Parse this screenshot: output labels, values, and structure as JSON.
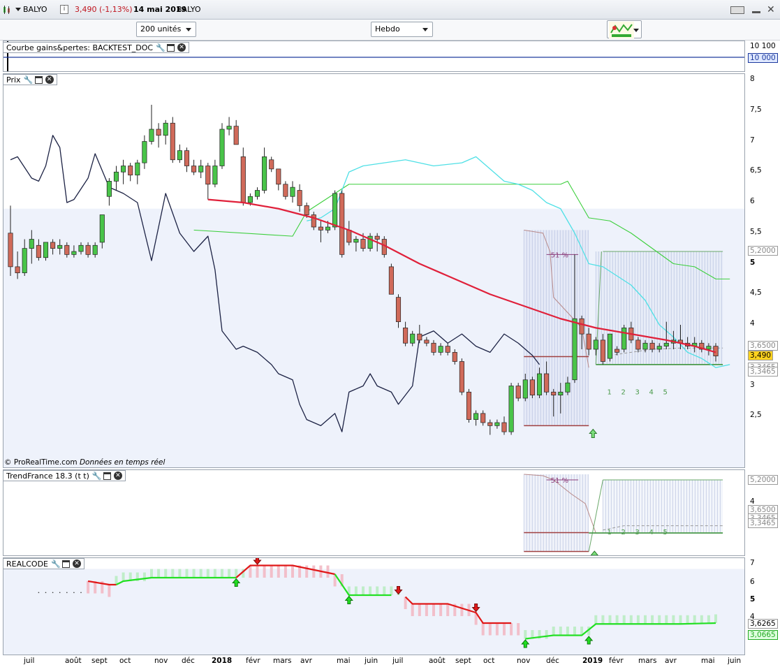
{
  "header": {
    "symbol": "BALYO",
    "price_change": "3,490 (-1,13%)",
    "date": "14 mai 2019",
    "name": "BALYO"
  },
  "toolbar": {
    "units": "200 unités",
    "timeframe": "Hebdo"
  },
  "panels": {
    "equity": {
      "title": "Courbe gains&pertes: BACKTEST_DOC",
      "axis": [
        "10 100"
      ],
      "tag": "10 000"
    },
    "price": {
      "title": "Prix",
      "axis": [
        "8",
        "7,5",
        "7",
        "6,5",
        "6",
        "5,5",
        "5",
        "4,5",
        "4",
        "3",
        "2,5"
      ],
      "tags": {
        "t1": "5,2000",
        "t2": "3,6500",
        "t3": "3,490",
        "t4": "3,3465",
        "t5": "3,3465"
      },
      "pct_label": "51 %",
      "counts": [
        "1",
        "2",
        "3",
        "4",
        "5"
      ],
      "copyright": "© ProRealTime.com",
      "realtime": "Données en temps réel"
    },
    "trend": {
      "title": "TrendFrance 18.3 (t t)",
      "axis": [
        "4"
      ],
      "tags": {
        "t1": "5,2000",
        "t2": "3,6500",
        "t3": "3,3465",
        "t4": "3,3465"
      },
      "pct_label": "51 %",
      "counts": [
        "1",
        "2",
        "3",
        "4",
        "5"
      ]
    },
    "realcode": {
      "title": "REALCODE",
      "axis": [
        "7",
        "6",
        "5",
        "4"
      ],
      "tags": {
        "t1": "3,6265",
        "t2": "3,0665"
      }
    }
  },
  "x_axis": [
    "juil",
    "août",
    "sept",
    "oct",
    "nov",
    "déc",
    "2018",
    "févr",
    "mars",
    "avr",
    "mai",
    "juin",
    "juil",
    "août",
    "sept",
    "oct",
    "nov",
    "déc",
    "2019",
    "févr",
    "mars",
    "avr",
    "mai",
    "juin"
  ],
  "colors": {
    "bull": "#49c449",
    "bear": "#d06a5a",
    "ma_red": "#e0203a",
    "cyan": "#4fe0e6",
    "green_line": "#3ccf3c",
    "navy": "#1c2244",
    "blue_zone": "#eef2fb"
  },
  "chart_data": {
    "type": "line",
    "title": "BALYO",
    "ylim": [
      2.1,
      8.1
    ],
    "candles": [
      [
        5.5,
        5.95,
        4.8,
        4.95
      ],
      [
        4.95,
        5.2,
        4.75,
        4.85
      ],
      [
        4.85,
        5.4,
        4.8,
        5.25
      ],
      [
        5.25,
        5.55,
        5.0,
        5.4
      ],
      [
        5.3,
        5.4,
        5.05,
        5.1
      ],
      [
        5.1,
        5.35,
        5.05,
        5.35
      ],
      [
        5.35,
        5.4,
        5.15,
        5.25
      ],
      [
        5.25,
        5.4,
        5.15,
        5.3
      ],
      [
        5.3,
        5.35,
        5.1,
        5.15
      ],
      [
        5.15,
        5.3,
        5.1,
        5.2
      ],
      [
        5.2,
        5.35,
        5.15,
        5.3
      ],
      [
        5.3,
        5.35,
        5.1,
        5.15
      ],
      [
        5.15,
        5.35,
        5.1,
        5.3
      ],
      [
        5.35,
        5.5,
        5.25,
        5.8
      ],
      [
        6.1,
        6.4,
        5.95,
        6.35
      ],
      [
        6.35,
        6.6,
        6.2,
        6.5
      ],
      [
        6.5,
        6.7,
        6.3,
        6.6
      ],
      [
        6.6,
        6.65,
        6.35,
        6.45
      ],
      [
        6.45,
        6.7,
        6.3,
        6.65
      ],
      [
        6.65,
        7.1,
        6.55,
        7.0
      ],
      [
        7.0,
        7.6,
        6.95,
        7.2
      ],
      [
        7.2,
        7.3,
        6.9,
        7.1
      ],
      [
        7.1,
        7.35,
        6.95,
        7.3
      ],
      [
        7.3,
        7.4,
        6.65,
        6.7
      ],
      [
        6.7,
        6.95,
        6.65,
        6.85
      ],
      [
        6.85,
        6.9,
        6.5,
        6.6
      ],
      [
        6.6,
        6.7,
        6.45,
        6.5
      ],
      [
        6.5,
        6.7,
        6.4,
        6.6
      ],
      [
        6.6,
        6.65,
        6.05,
        6.3
      ],
      [
        6.3,
        6.7,
        6.25,
        6.6
      ],
      [
        6.6,
        7.3,
        6.55,
        7.2
      ],
      [
        7.2,
        7.4,
        7.1,
        7.25
      ],
      [
        7.25,
        7.35,
        6.95,
        6.95
      ],
      [
        6.75,
        6.9,
        5.95,
        6.0
      ],
      [
        6.0,
        6.15,
        5.95,
        6.1
      ],
      [
        6.1,
        6.25,
        6.05,
        6.2
      ],
      [
        6.2,
        6.9,
        6.15,
        6.75
      ],
      [
        6.7,
        6.75,
        6.5,
        6.55
      ],
      [
        6.55,
        6.55,
        6.2,
        6.3
      ],
      [
        6.3,
        6.35,
        6.05,
        6.1
      ],
      [
        6.1,
        6.35,
        6.0,
        6.25
      ],
      [
        6.2,
        6.3,
        5.85,
        5.95
      ],
      [
        5.95,
        6.0,
        5.75,
        5.8
      ],
      [
        5.8,
        5.85,
        5.55,
        5.6
      ],
      [
        5.6,
        5.7,
        5.35,
        5.55
      ],
      [
        5.55,
        5.7,
        5.5,
        5.6
      ],
      [
        5.6,
        6.2,
        5.55,
        6.15
      ],
      [
        6.15,
        6.2,
        5.1,
        5.15
      ],
      [
        5.55,
        5.7,
        5.3,
        5.35
      ],
      [
        5.35,
        5.45,
        5.2,
        5.4
      ],
      [
        5.4,
        5.5,
        5.2,
        5.25
      ],
      [
        5.25,
        5.5,
        5.2,
        5.45
      ],
      [
        5.45,
        5.5,
        5.2,
        5.4
      ],
      [
        5.4,
        5.45,
        5.1,
        5.15
      ],
      [
        4.95,
        5.0,
        4.5,
        4.5
      ],
      [
        4.45,
        4.5,
        3.95,
        4.05
      ],
      [
        3.95,
        4.05,
        3.65,
        3.7
      ],
      [
        3.7,
        3.9,
        3.65,
        3.85
      ],
      [
        3.85,
        4.0,
        3.7,
        3.75
      ],
      [
        3.75,
        3.8,
        3.65,
        3.7
      ],
      [
        3.7,
        3.75,
        3.5,
        3.55
      ],
      [
        3.55,
        3.7,
        3.5,
        3.65
      ],
      [
        3.65,
        3.7,
        3.5,
        3.55
      ],
      [
        3.55,
        3.6,
        3.35,
        3.4
      ],
      [
        3.4,
        3.45,
        2.85,
        2.9
      ],
      [
        2.9,
        2.95,
        2.4,
        2.45
      ],
      [
        2.45,
        2.6,
        2.35,
        2.55
      ],
      [
        2.55,
        2.6,
        2.35,
        2.4
      ],
      [
        2.4,
        2.45,
        2.2,
        2.35
      ],
      [
        2.35,
        2.45,
        2.3,
        2.4
      ],
      [
        2.4,
        2.5,
        2.2,
        2.25
      ],
      [
        2.25,
        3.05,
        2.2,
        3.0
      ],
      [
        3.0,
        3.05,
        2.75,
        2.8
      ],
      [
        2.8,
        3.2,
        2.75,
        3.1
      ],
      [
        3.1,
        3.15,
        2.8,
        2.85
      ],
      [
        2.85,
        3.3,
        2.8,
        3.2
      ],
      [
        3.2,
        3.4,
        2.85,
        2.9
      ],
      [
        2.9,
        2.95,
        2.5,
        2.85
      ],
      [
        2.85,
        3.05,
        2.55,
        2.9
      ],
      [
        2.9,
        3.15,
        2.85,
        3.05
      ],
      [
        3.1,
        5.15,
        3.05,
        4.1
      ],
      [
        4.1,
        4.15,
        3.6,
        3.85
      ],
      [
        3.85,
        3.95,
        3.5,
        3.6
      ],
      [
        3.6,
        3.8,
        3.5,
        3.75
      ],
      [
        3.75,
        3.85,
        3.35,
        3.4
      ],
      [
        3.45,
        3.85,
        3.4,
        3.85
      ],
      [
        3.6,
        3.65,
        3.5,
        3.55
      ],
      [
        3.6,
        4.0,
        3.55,
        3.95
      ],
      [
        3.95,
        4.05,
        3.7,
        3.75
      ],
      [
        3.75,
        3.8,
        3.55,
        3.6
      ],
      [
        3.6,
        3.75,
        3.55,
        3.7
      ],
      [
        3.7,
        3.75,
        3.55,
        3.6
      ],
      [
        3.6,
        3.7,
        3.55,
        3.65
      ],
      [
        3.65,
        4.05,
        3.6,
        3.7
      ],
      [
        3.7,
        3.9,
        3.6,
        3.75
      ],
      [
        3.75,
        4.0,
        3.6,
        3.7
      ],
      [
        3.7,
        3.8,
        3.6,
        3.65
      ],
      [
        3.65,
        3.8,
        3.55,
        3.7
      ],
      [
        3.7,
        3.75,
        3.55,
        3.6
      ],
      [
        3.6,
        3.7,
        3.5,
        3.65
      ],
      [
        3.65,
        3.7,
        3.4,
        3.49
      ]
    ],
    "ma": [
      [
        28,
        6.05
      ],
      [
        33,
        6.0
      ],
      [
        38,
        5.9
      ],
      [
        43,
        5.75
      ],
      [
        48,
        5.55
      ],
      [
        53,
        5.3
      ],
      [
        58,
        5.0
      ],
      [
        63,
        4.75
      ],
      [
        68,
        4.5
      ],
      [
        73,
        4.3
      ],
      [
        78,
        4.1
      ],
      [
        83,
        3.95
      ],
      [
        88,
        3.85
      ],
      [
        93,
        3.75
      ],
      [
        97,
        3.65
      ],
      [
        100,
        3.55
      ]
    ],
    "cyan": [
      [
        42,
        5.7
      ],
      [
        44,
        5.75
      ],
      [
        46,
        5.9
      ],
      [
        48,
        6.5
      ],
      [
        50,
        6.6
      ],
      [
        53,
        6.65
      ],
      [
        56,
        6.7
      ],
      [
        60,
        6.6
      ],
      [
        64,
        6.65
      ],
      [
        66,
        6.75
      ],
      [
        68,
        6.55
      ],
      [
        70,
        6.35
      ],
      [
        72,
        6.3
      ],
      [
        74,
        6.2
      ],
      [
        76,
        6.0
      ],
      [
        78,
        5.9
      ],
      [
        80,
        5.5
      ],
      [
        82,
        5.0
      ],
      [
        84,
        4.95
      ],
      [
        86,
        4.8
      ],
      [
        88,
        4.65
      ],
      [
        90,
        4.4
      ],
      [
        92,
        4.0
      ],
      [
        94,
        3.8
      ],
      [
        96,
        3.55
      ],
      [
        98,
        3.45
      ],
      [
        100,
        3.3
      ],
      [
        102,
        3.35
      ]
    ],
    "green": [
      [
        26,
        5.55
      ],
      [
        40,
        5.45
      ],
      [
        42,
        5.85
      ],
      [
        48,
        6.3
      ],
      [
        78,
        6.3
      ],
      [
        79,
        6.35
      ],
      [
        82,
        5.75
      ],
      [
        85,
        5.7
      ],
      [
        88,
        5.5
      ],
      [
        91,
        5.25
      ],
      [
        94,
        5.0
      ],
      [
        97,
        4.95
      ],
      [
        100,
        4.75
      ],
      [
        102,
        4.75
      ]
    ],
    "navy": [
      [
        0,
        6.7
      ],
      [
        1,
        6.75
      ],
      [
        3,
        6.4
      ],
      [
        4,
        6.35
      ],
      [
        5,
        6.6
      ],
      [
        6,
        7.1
      ],
      [
        7,
        6.9
      ],
      [
        8,
        6.0
      ],
      [
        9,
        6.05
      ],
      [
        11,
        6.4
      ],
      [
        12,
        6.8
      ],
      [
        14,
        6.25
      ],
      [
        16,
        6.15
      ],
      [
        18,
        6.0
      ],
      [
        20,
        5.05
      ],
      [
        22,
        6.15
      ],
      [
        24,
        5.5
      ],
      [
        26,
        5.2
      ],
      [
        28,
        5.45
      ],
      [
        29,
        4.9
      ],
      [
        30,
        3.9
      ],
      [
        32,
        3.6
      ],
      [
        33,
        3.65
      ],
      [
        35,
        3.55
      ],
      [
        37,
        3.35
      ],
      [
        38,
        3.2
      ],
      [
        40,
        3.1
      ],
      [
        41,
        2.7
      ],
      [
        42,
        2.45
      ],
      [
        44,
        2.35
      ],
      [
        46,
        2.55
      ],
      [
        47,
        2.25
      ],
      [
        48,
        2.9
      ],
      [
        50,
        3.0
      ],
      [
        51,
        3.2
      ],
      [
        52,
        3.0
      ],
      [
        54,
        2.9
      ],
      [
        55,
        2.7
      ],
      [
        57,
        3.0
      ],
      [
        58,
        3.8
      ],
      [
        60,
        3.9
      ],
      [
        62,
        3.7
      ],
      [
        64,
        3.85
      ],
      [
        66,
        3.65
      ],
      [
        68,
        3.55
      ],
      [
        70,
        3.85
      ],
      [
        72,
        3.7
      ],
      [
        74,
        3.5
      ],
      [
        75,
        3.35
      ]
    ]
  }
}
